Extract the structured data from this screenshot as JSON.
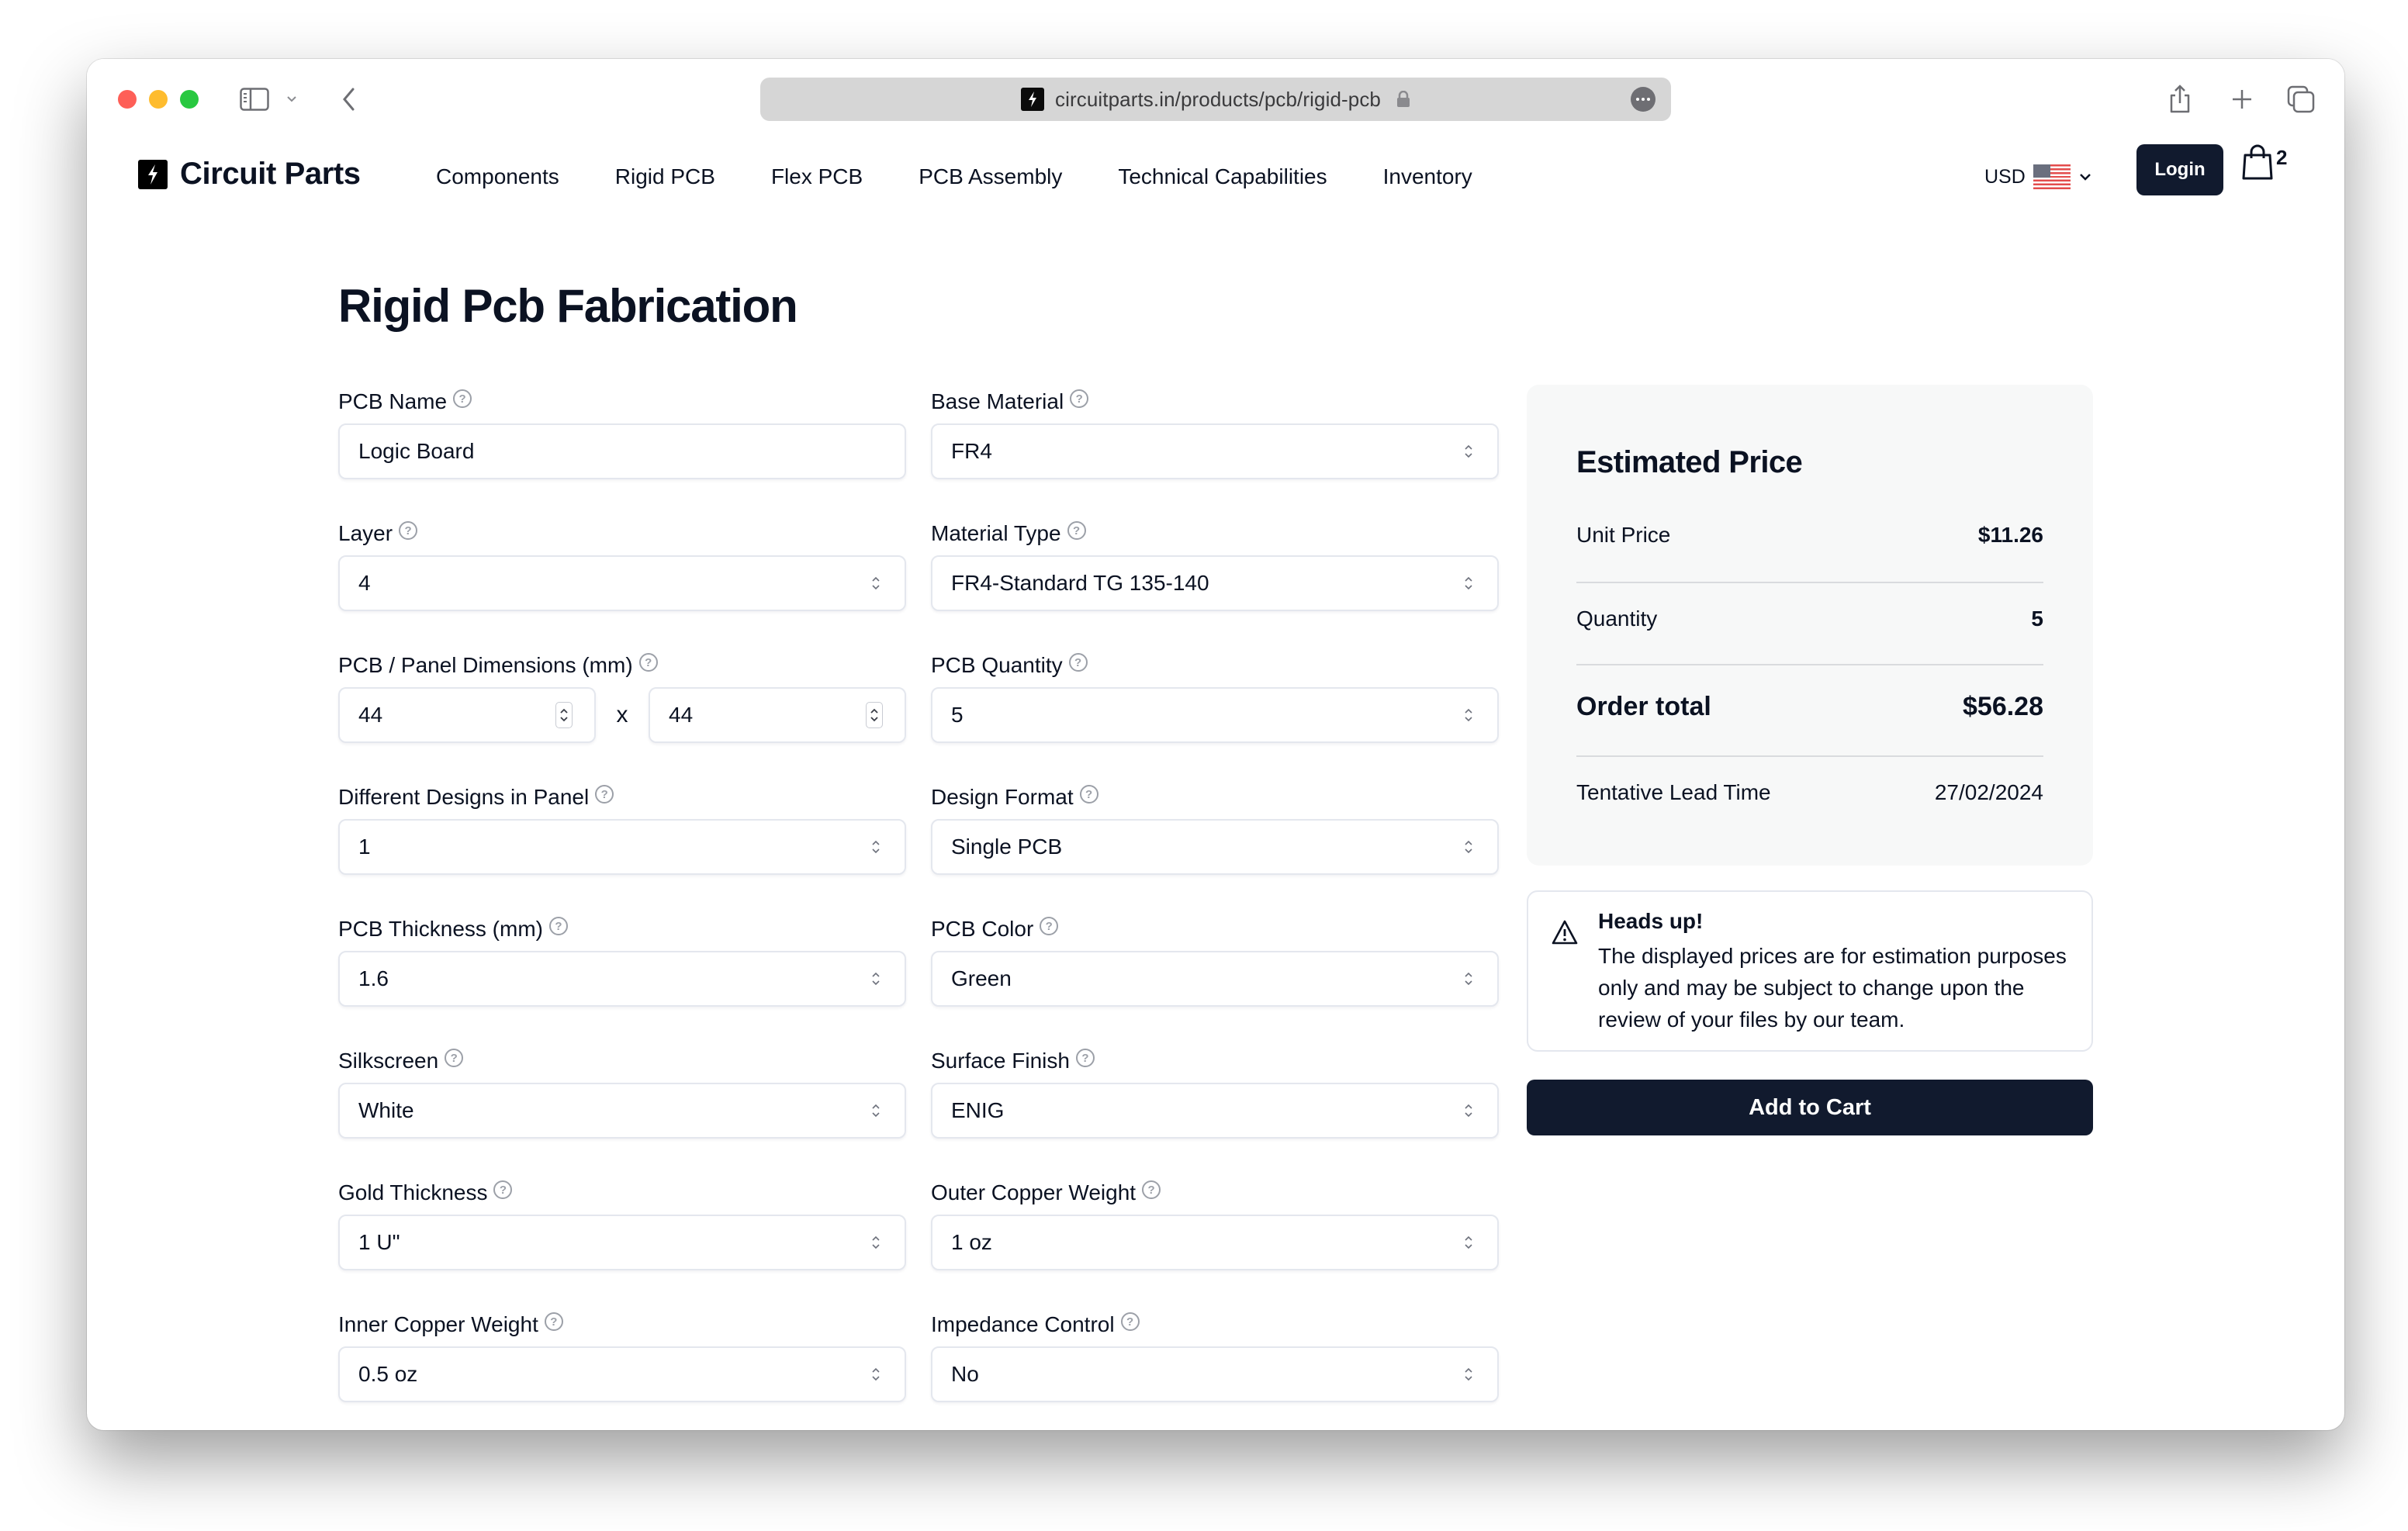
{
  "browser": {
    "url": "circuitparts.in/products/pcb/rigid-pcb",
    "icons": [
      "sidebar-toggle-icon",
      "chevron-down-icon",
      "back-icon",
      "lock-icon",
      "more-icon",
      "share-icon",
      "new-tab-icon",
      "tabs-overview-icon"
    ]
  },
  "header": {
    "brand": "Circuit Parts",
    "nav": [
      "Components",
      "Rigid PCB",
      "Flex PCB",
      "PCB Assembly",
      "Technical Capabilities",
      "Inventory"
    ],
    "currency": "USD",
    "login_label": "Login",
    "cart_count": "2"
  },
  "page": {
    "title": "Rigid Pcb Fabrication"
  },
  "form": {
    "pcb_name": {
      "label": "PCB Name",
      "value": "Logic Board"
    },
    "layer": {
      "label": "Layer",
      "value": "4"
    },
    "dimensions": {
      "label": "PCB / Panel Dimensions (mm)",
      "width": "44",
      "height": "44",
      "separator": "x"
    },
    "designs_in_panel": {
      "label": "Different Designs in Panel",
      "value": "1"
    },
    "thickness": {
      "label": "PCB Thickness (mm)",
      "value": "1.6"
    },
    "silkscreen": {
      "label": "Silkscreen",
      "value": "White"
    },
    "gold_thickness": {
      "label": "Gold Thickness",
      "value": "1 U\""
    },
    "inner_copper": {
      "label": "Inner Copper Weight",
      "value": "0.5 oz"
    },
    "base_material": {
      "label": "Base Material",
      "value": "FR4"
    },
    "material_type": {
      "label": "Material Type",
      "value": "FR4-Standard TG 135-140"
    },
    "quantity": {
      "label": "PCB Quantity",
      "value": "5"
    },
    "design_format": {
      "label": "Design Format",
      "value": "Single PCB"
    },
    "color": {
      "label": "PCB Color",
      "value": "Green"
    },
    "surface_finish": {
      "label": "Surface Finish",
      "value": "ENIG"
    },
    "outer_copper": {
      "label": "Outer Copper Weight",
      "value": "1 oz"
    },
    "impedance": {
      "label": "Impedance Control",
      "value": "No"
    }
  },
  "price": {
    "title": "Estimated Price",
    "unit_price_label": "Unit Price",
    "unit_price": "$11.26",
    "quantity_label": "Quantity",
    "quantity": "5",
    "total_label": "Order total",
    "total": "$56.28",
    "lead_label": "Tentative Lead Time",
    "lead": "27/02/2024"
  },
  "alert": {
    "title": "Heads up!",
    "body": "The displayed prices are for estimation purposes only and may be subject to change upon the review of your files by our team."
  },
  "cart_button": "Add to Cart",
  "colors": {
    "primary": "#111a2e",
    "card_bg": "#f7f8f8",
    "border": "#e4e7ee"
  }
}
